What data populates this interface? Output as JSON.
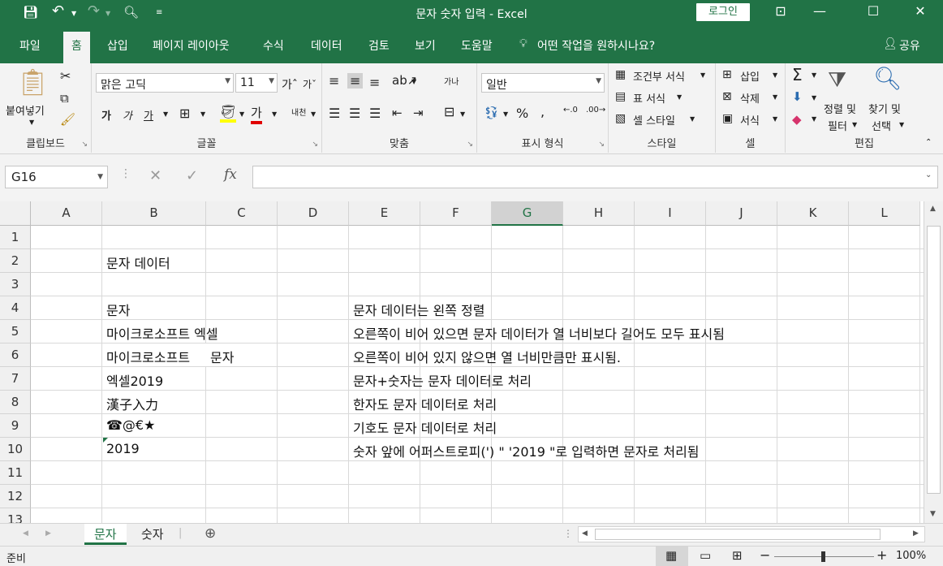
{
  "window": {
    "title": "문자 숫자 입력  -  Excel",
    "login_label": "로그인"
  },
  "ribbon_tabs": [
    "파일",
    "홈",
    "삽입",
    "페이지 레이아웃",
    "수식",
    "데이터",
    "검토",
    "보기",
    "도움말"
  ],
  "tell_me": "어떤 작업을 원하시나요?",
  "share_label": "공유",
  "ribbon": {
    "clipboard": {
      "paste": "붙여넣기",
      "label": "클립보드"
    },
    "font": {
      "name": "맑은 고딕",
      "size": "11",
      "label": "글꼴",
      "bold": "가",
      "italic": "가",
      "underline": "가",
      "color_glyph": "가",
      "phonetic": "내천"
    },
    "alignment": {
      "label": "맞춤",
      "wrap": "가나"
    },
    "number": {
      "format": "일반",
      "label": "표시 형식"
    },
    "styles": {
      "conditional": "조건부 서식",
      "table": "표 서식",
      "cell": "셀 스타일",
      "label": "스타일"
    },
    "cells": {
      "insert": "삽입",
      "delete": "삭제",
      "format": "서식",
      "label": "셀"
    },
    "editing": {
      "sort_line1": "정렬 및",
      "sort_line2": "필터",
      "find_line1": "찾기 및",
      "find_line2": "선택",
      "label": "편집"
    }
  },
  "formula_bar": {
    "name_box": "G16",
    "formula": ""
  },
  "columns": [
    "A",
    "B",
    "C",
    "D",
    "E",
    "F",
    "G",
    "H",
    "I",
    "J",
    "K",
    "L"
  ],
  "selected_column": "G",
  "rows": [
    "1",
    "2",
    "3",
    "4",
    "5",
    "6",
    "7",
    "8",
    "9",
    "10",
    "11",
    "12",
    "13"
  ],
  "cells": {
    "B2": "문자 데이터",
    "B4": "문자",
    "E4": "문자 데이터는 왼쪽 정렬",
    "B5": "마이크로소프트 엑셀",
    "E5": "오른쪽이 비어 있으면 문자 데이터가 열 너비보다 길어도 모두 표시됨",
    "B6": "마이크로소프트",
    "C6": "문자",
    "E6": "오른쪽이 비어 있지 않으면 열 너비만큼만 표시됨.",
    "B7": "엑셀2019",
    "E7": "문자+숫자는 문자 데이터로 처리",
    "B8": "漢子入力",
    "E8": "한자도 문자 데이터로 처리",
    "B9": "☎@€★",
    "E9": "기호도 문자 데이터로 처리",
    "B10": "2019",
    "E10": "숫자 앞에 어퍼스트로피(') \" '2019 \"로 입력하면 문자로 처리됨"
  },
  "sheets": [
    "문자",
    "숫자"
  ],
  "active_sheet": "문자",
  "status": {
    "mode": "준비",
    "zoom": "100%"
  },
  "colors": {
    "brand": "#217346"
  }
}
